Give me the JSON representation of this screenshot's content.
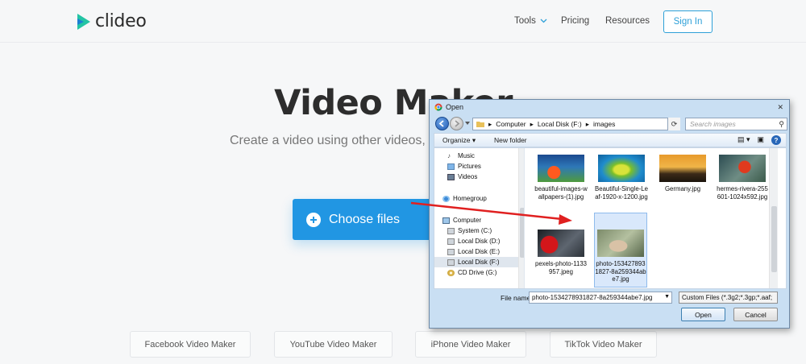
{
  "header": {
    "logo_text": "clideo",
    "nav": {
      "tools": "Tools",
      "pricing": "Pricing",
      "resources": "Resources"
    },
    "signin": "Sign In"
  },
  "hero": {
    "title": "Video Maker",
    "subtitle": "Create a video using other videos, p",
    "choose_button": "Choose files"
  },
  "maker_links": [
    "Facebook Video Maker",
    "YouTube Video Maker",
    "iPhone Video Maker",
    "TikTok Video Maker"
  ],
  "dialog": {
    "title": "Open",
    "address": {
      "segments": [
        "Computer",
        "Local Disk (F:)",
        "images"
      ]
    },
    "search_placeholder": "Search images",
    "toolbar": {
      "organize": "Organize ▾",
      "new_folder": "New folder"
    },
    "tree": [
      {
        "label": "Music",
        "icon": "music-icon"
      },
      {
        "label": "Pictures",
        "icon": "pictures-icon"
      },
      {
        "label": "Videos",
        "icon": "videos-icon"
      },
      {
        "label": "Homegroup",
        "icon": "homegroup-icon"
      },
      {
        "label": "Computer",
        "icon": "computer-icon"
      },
      {
        "label": "System (C:)",
        "icon": "drive-icon"
      },
      {
        "label": "Local Disk (D:)",
        "icon": "drive-icon"
      },
      {
        "label": "Local Disk (E:)",
        "icon": "drive-icon"
      },
      {
        "label": "Local Disk (F:)",
        "icon": "drive-icon"
      },
      {
        "label": "CD Drive (G:)",
        "icon": "cd-drive-icon"
      }
    ],
    "files": [
      {
        "name": "beautiful-images-wallpapers-(1).jpg"
      },
      {
        "name": "Beautiful-Single-Leaf-1920-x-1200.jpg"
      },
      {
        "name": "Germany.jpg"
      },
      {
        "name": "hermes-rivera-255601-1024x592.jpg"
      },
      {
        "name": "pexels-photo-1133957.jpeg"
      },
      {
        "name": "photo-1534278931827-8a259344abe7.jpg"
      }
    ],
    "file_name_label": "File name:",
    "file_name_value": "photo-1534278931827-8a259344abe7.jpg",
    "file_type_value": "Custom Files (*.3g2;*.3gp;*.aaf;",
    "open_button": "Open",
    "cancel_button": "Cancel"
  },
  "colors": {
    "accent": "#2196e3",
    "arrow": "#e02020",
    "dialog_frame": "#c9dff3"
  }
}
